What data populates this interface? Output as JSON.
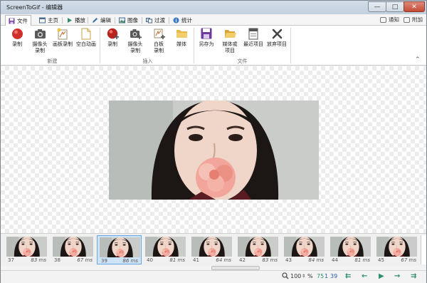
{
  "window": {
    "title": "ScreenToGif - 编辑器",
    "controls": {
      "minimize": "—",
      "maximize": "□",
      "close": "✕"
    }
  },
  "tabs": [
    {
      "label": "文件",
      "icon": "save-icon",
      "active": true
    },
    {
      "label": "主页",
      "icon": "home-icon",
      "active": false
    },
    {
      "label": "播放",
      "icon": "play-icon",
      "active": false
    },
    {
      "label": "编辑",
      "icon": "pencil-icon",
      "active": false
    },
    {
      "label": "图像",
      "icon": "image-icon",
      "active": false
    },
    {
      "label": "过渡",
      "icon": "transition-icon",
      "active": false
    },
    {
      "label": "统计",
      "icon": "info-icon",
      "active": false
    }
  ],
  "right_tabs": {
    "notify": "通知",
    "attach": "附加"
  },
  "ribbon": {
    "groups": [
      {
        "label": "新建",
        "buttons": [
          {
            "label": "录制",
            "icon": "record-icon"
          },
          {
            "label": "摄像头\n录制",
            "icon": "camera-icon"
          },
          {
            "label": "画板录制",
            "icon": "board-icon"
          },
          {
            "label": "空白动画",
            "icon": "blank-icon"
          }
        ]
      },
      {
        "label": "插入",
        "buttons": [
          {
            "label": "录制",
            "icon": "record-add-icon"
          },
          {
            "label": "摄像头\n录制",
            "icon": "camera-add-icon"
          },
          {
            "label": "白板\n录制",
            "icon": "board-add-icon"
          },
          {
            "label": "媒体",
            "icon": "folder-icon"
          }
        ]
      },
      {
        "label": "文件",
        "buttons": [
          {
            "label": "另存为",
            "icon": "save-as-icon"
          },
          {
            "label": "媒体或\n项目",
            "icon": "folder-open-icon"
          },
          {
            "label": "最近项目",
            "icon": "recent-icon"
          },
          {
            "label": "放弃项目",
            "icon": "discard-icon"
          }
        ]
      }
    ]
  },
  "filmstrip": {
    "frames": [
      {
        "number": "37",
        "delay": "83 ms",
        "selected": false
      },
      {
        "number": "38",
        "delay": "67 ms",
        "selected": false
      },
      {
        "number": "39",
        "delay": "86 ms",
        "selected": true
      },
      {
        "number": "40",
        "delay": "81 ms",
        "selected": false
      },
      {
        "number": "41",
        "delay": "64 ms",
        "selected": false
      },
      {
        "number": "42",
        "delay": "83 ms",
        "selected": false
      },
      {
        "number": "43",
        "delay": "84 ms",
        "selected": false
      },
      {
        "number": "44",
        "delay": "81 ms",
        "selected": false
      },
      {
        "number": "45",
        "delay": "67 ms",
        "selected": false
      }
    ]
  },
  "statusbar": {
    "zoom": "100",
    "zoom_unit": "%",
    "frame_count": "75",
    "selected_count": "1",
    "current_frame": "39"
  },
  "colors": {
    "selected_frame": "#cde3f7",
    "record_red": "#d0302a",
    "nav_green": "#2f8d6a"
  }
}
